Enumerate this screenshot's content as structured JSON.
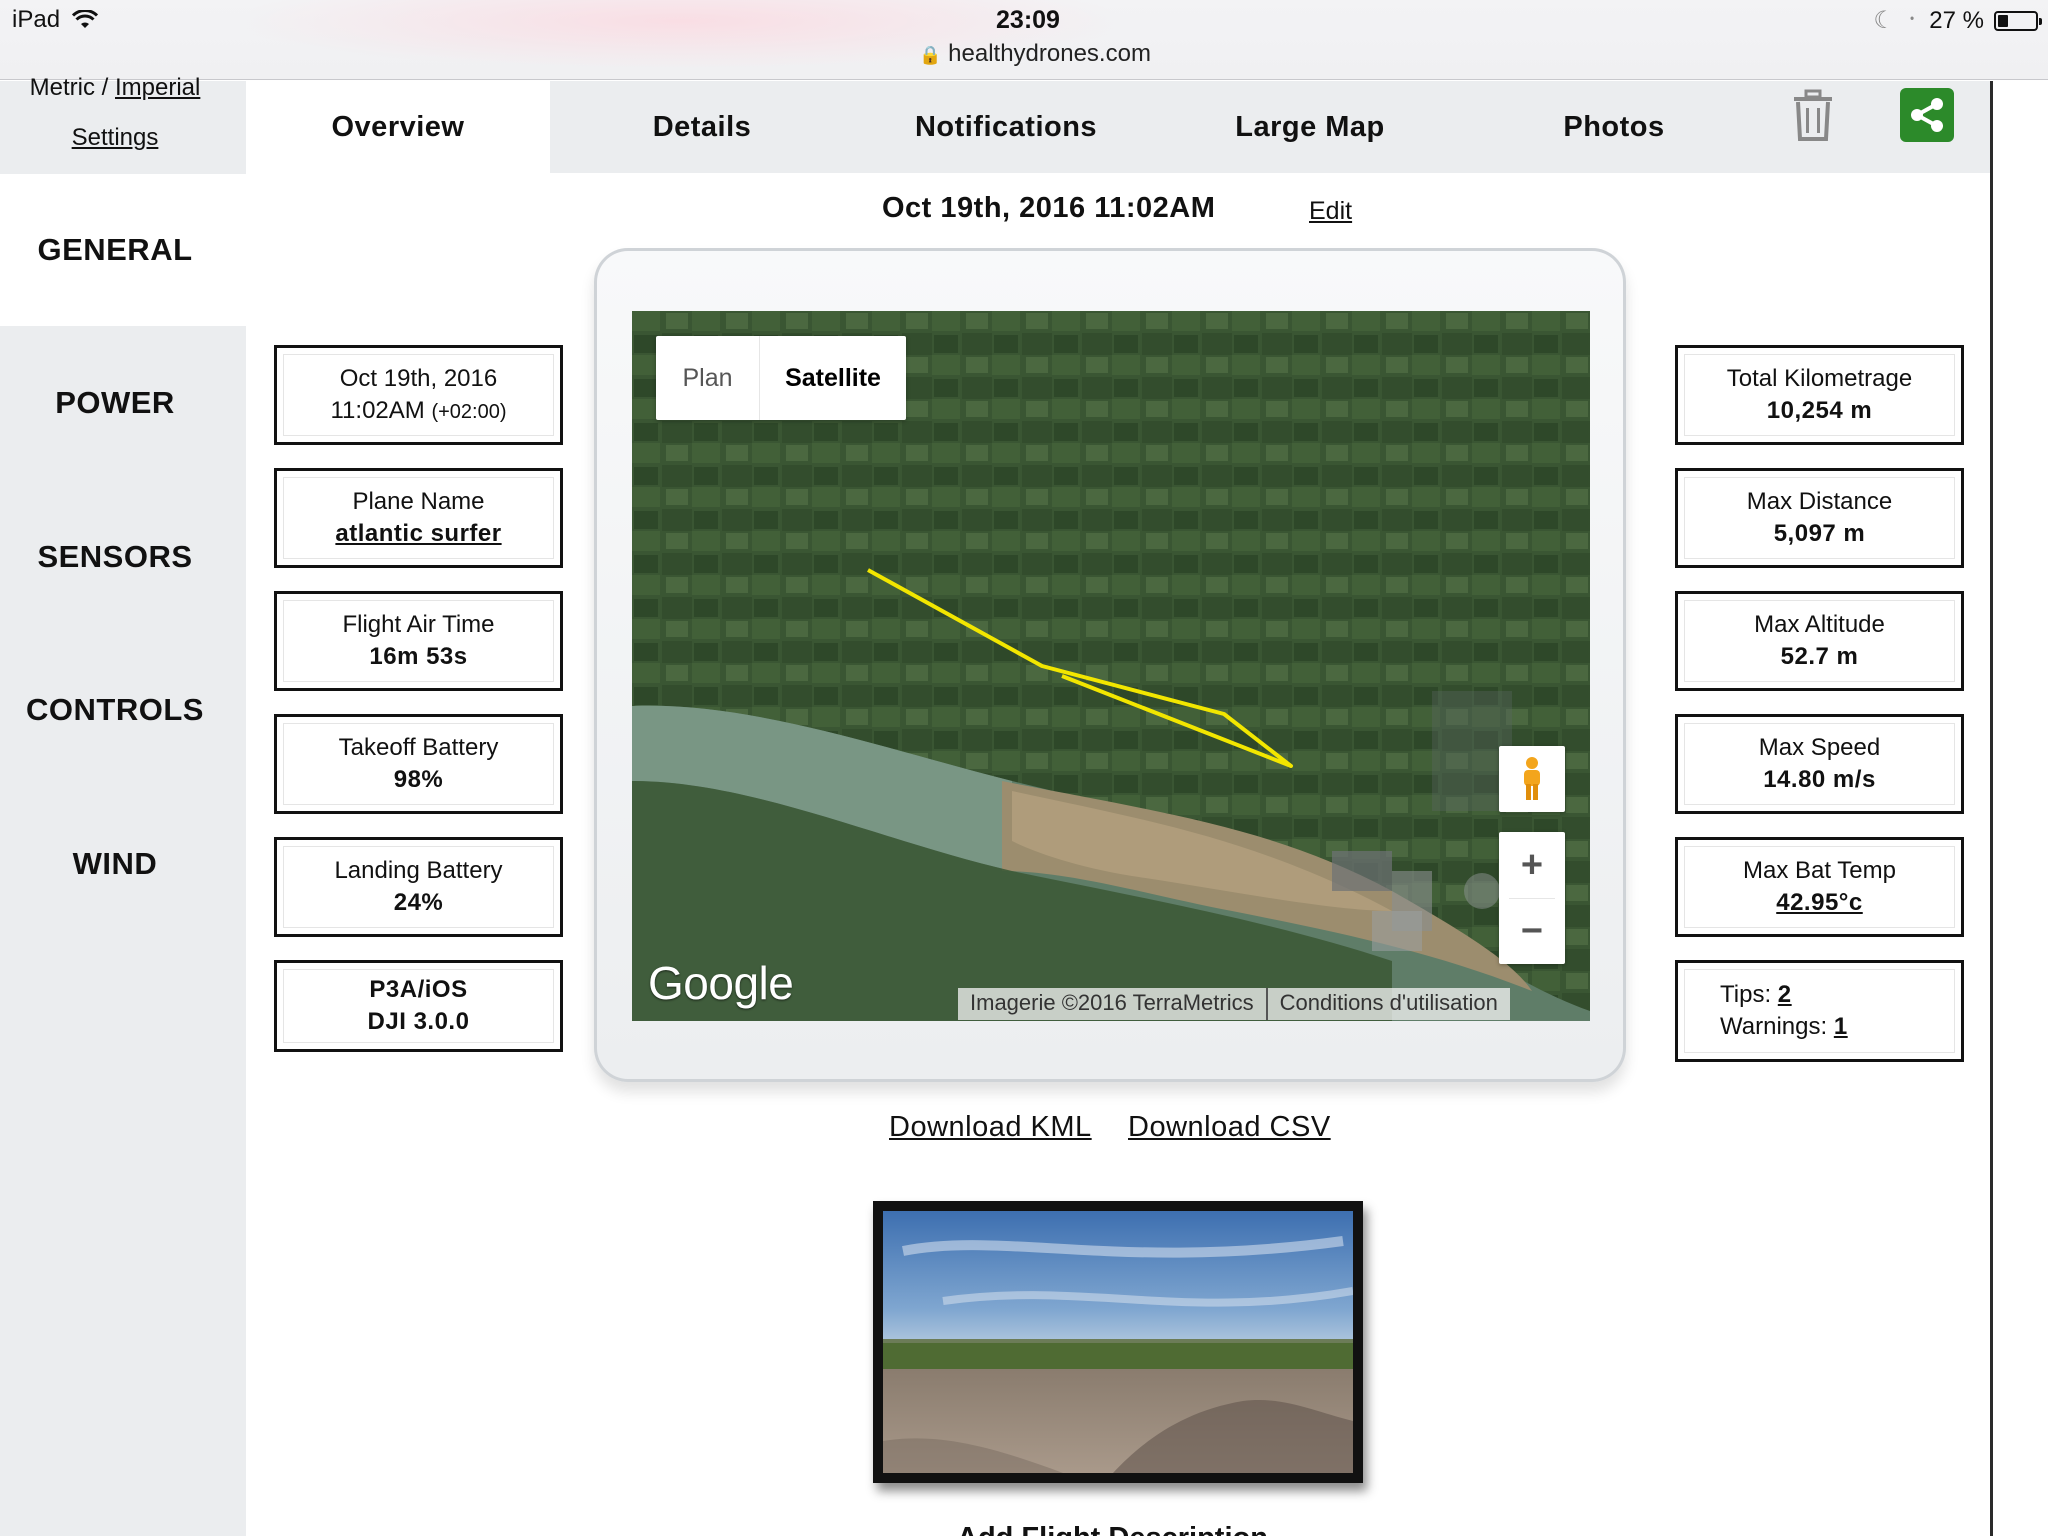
{
  "status_bar": {
    "device": "iPad",
    "time": "23:09",
    "url": "healthydrones.com",
    "battery_text": "27 %",
    "battery_level": 0.27
  },
  "left_nav": {
    "units_metric": "Metric",
    "units_separator": "/",
    "units_imperial": "Imperial",
    "settings": "Settings",
    "items": [
      "GENERAL",
      "POWER",
      "SENSORS",
      "CONTROLS",
      "WIND"
    ],
    "active_item": "GENERAL"
  },
  "tabs": {
    "items": [
      "Overview",
      "Details",
      "Notifications",
      "Large Map",
      "Photos"
    ],
    "active": "Overview",
    "share_color": "#2c8a2a"
  },
  "flight": {
    "date_header": "Oct 19th, 2016 11:02AM",
    "edit": "Edit"
  },
  "left_stats": {
    "date_line1": "Oct 19th, 2016",
    "date_line2": "11:02AM",
    "date_tz": "(+02:00)",
    "plane_label": "Plane Name",
    "plane_value": "atlantic surfer",
    "airtime_label": "Flight Air Time",
    "airtime_value": "16m 53s",
    "takeoff_label": "Takeoff Battery",
    "takeoff_value": "98%",
    "landing_label": "Landing Battery",
    "landing_value": "24%",
    "platform_line1": "P3A/iOS",
    "platform_line2": "DJI 3.0.0"
  },
  "right_stats": {
    "kilometrage_label": "Total Kilometrage",
    "kilometrage_value": "10,254 m",
    "maxdist_label": "Max Distance",
    "maxdist_value": "5,097 m",
    "maxalt_label": "Max Altitude",
    "maxalt_value": "52.7 m",
    "maxspeed_label": "Max Speed",
    "maxspeed_value": "14.80 m/s",
    "battemp_label": "Max Bat Temp",
    "battemp_value": "42.95°c",
    "tips_label": "Tips:",
    "tips_value": "2",
    "warnings_label": "Warnings:",
    "warnings_value": "1"
  },
  "map": {
    "type_plan": "Plan",
    "type_satellite": "Satellite",
    "active_type": "Satellite",
    "logo": "Google",
    "imagery": "Imagerie ©2016 TerraMetrics",
    "terms": "Conditions d'utilisation",
    "zoom_in": "+",
    "zoom_out": "−",
    "track_color": "#f2e600"
  },
  "downloads": {
    "kml": "Download KML",
    "csv": "Download CSV"
  },
  "footer": {
    "add_description": "Add Flight Description"
  }
}
